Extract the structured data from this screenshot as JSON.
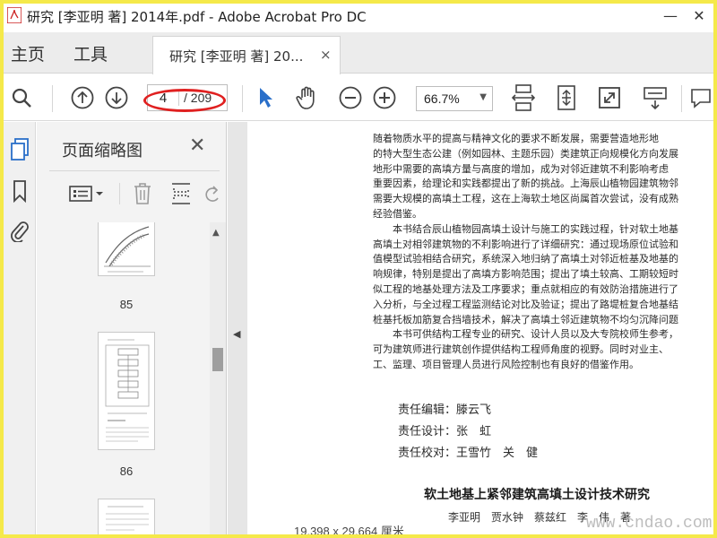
{
  "window": {
    "title": "研究 [李亚明 著] 2014年.pdf - Adobe Acrobat Pro DC",
    "app_icon": "acrobat-icon",
    "controls": {
      "minimize": "—",
      "close": "✕"
    }
  },
  "tabs": {
    "home": "主页",
    "tools": "工具",
    "document": "研究 [李亚明 著] 20...",
    "document_close": "×"
  },
  "toolbar": {
    "current_page": "4",
    "total_pages": "/ 209",
    "zoom": "66.7%",
    "icons": [
      "search-icon",
      "page-up-icon",
      "page-down-icon",
      "select-arrow-icon",
      "hand-tool-icon",
      "zoom-out-icon",
      "zoom-in-icon",
      "fit-width-icon",
      "fit-page-icon",
      "fullscreen-icon",
      "read-mode-icon",
      "comment-icon"
    ],
    "annotation_color": "#e02020"
  },
  "sidebar": {
    "panel_title": "页面缩略图",
    "panel_close": "✕",
    "thumbnails": [
      {
        "page": "85"
      },
      {
        "page": "86"
      }
    ]
  },
  "document": {
    "body_lines": [
      "随着物质水平的提高与精神文化的要求不断发展，需要营造地形地",
      "的特大型生态公建（例如园林、主题乐园）类建筑正向规模化方向发展",
      "地形中需要的高填方量与高度的增加，成为对邻近建筑不利影响考虑",
      "重要因素，给理论和实践都提出了新的挑战。上海辰山植物园建筑物邻",
      "需要大规模的高填土工程，这在上海软土地区尚属首次尝试，没有成熟",
      "经验借鉴。",
      "　　本书结合辰山植物园高填土设计与施工的实践过程，针对软土地基",
      "高填土对相邻建筑物的不利影响进行了详细研究：通过现场原位试验和",
      "值模型试验相结合研究，系统深入地归纳了高填土对邻近桩基及地基的",
      "响规律，特别是提出了高填方影响范围；提出了填土较高、工期较短时",
      "似工程的地基处理方法及工序要求；重点就相应的有效防治措施进行了",
      "入分析，与全过程工程监测结论对比及验证；提出了路堤桩复合地基结",
      "桩基托板加筋复合挡墙技术，解决了高填土邻近建筑物不均匀沉降问题",
      "　　本书可供结构工程专业的研究、设计人员以及大专院校师生参考，",
      "可为建筑师进行建筑创作提供结构工程师角度的视野。同时对业主、",
      "工、监理、项目管理人员进行风险控制也有良好的借鉴作用。"
    ],
    "credits": [
      "责任编辑：滕云飞",
      "责任设计：张　虹",
      "责任校对：王雪竹　关　健"
    ],
    "book_title": "软土地基上紧邻建筑高填土设计技术研究",
    "authors": "李亚明　贾水钟　蔡兹红　李　伟　著"
  },
  "status": {
    "page_size": "19.398 x 29.664 厘米"
  },
  "watermark": "www.cndao.com"
}
